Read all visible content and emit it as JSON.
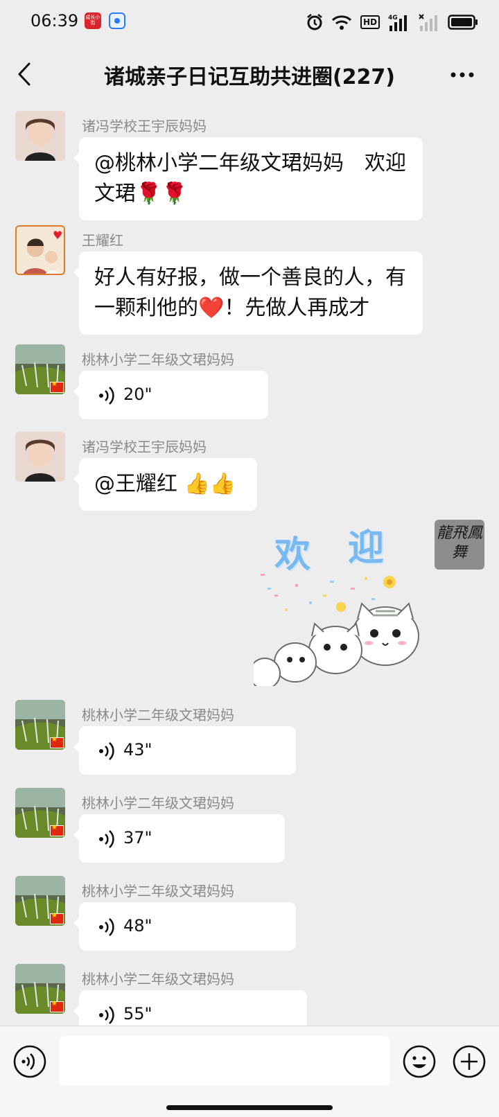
{
  "status_bar": {
    "time": "06:39",
    "badge_text": "成长小街",
    "hd_label": "HD",
    "network_label": "4G"
  },
  "header": {
    "title": "诸城亲子日记互助共进圈(227)"
  },
  "messages": [
    {
      "sender": "诸冯学校王宇辰妈妈",
      "type": "text",
      "text": "@桃林小学二年级文珺妈妈　欢迎文珺🌹🌹"
    },
    {
      "sender": "王耀红",
      "type": "text",
      "text": "好人有好报，做一个善良的人，有一颗利他的❤️！先做人再成才"
    },
    {
      "sender": "桃林小学二年级文珺妈妈",
      "type": "voice",
      "duration": "20\""
    },
    {
      "sender": "诸冯学校王宇辰妈妈",
      "type": "text",
      "text": "@王耀红 👍👍"
    },
    {
      "sender": "桃林小学二年级文珺妈妈",
      "type": "voice",
      "duration": "43\""
    },
    {
      "sender": "桃林小学二年级文珺妈妈",
      "type": "voice",
      "duration": "37\""
    },
    {
      "sender": "桃林小学二年级文珺妈妈",
      "type": "voice",
      "duration": "48\""
    },
    {
      "sender": "桃林小学二年级文珺妈妈",
      "type": "voice",
      "duration": "55\""
    }
  ],
  "sent_sticker": {
    "word1": "欢",
    "word2": "迎",
    "avatar_text": "龍飛鳳舞"
  },
  "input": {
    "placeholder": ""
  },
  "colors": {
    "background": "#ededed",
    "bubble": "#ffffff",
    "sender_text": "#8a8a8a"
  }
}
